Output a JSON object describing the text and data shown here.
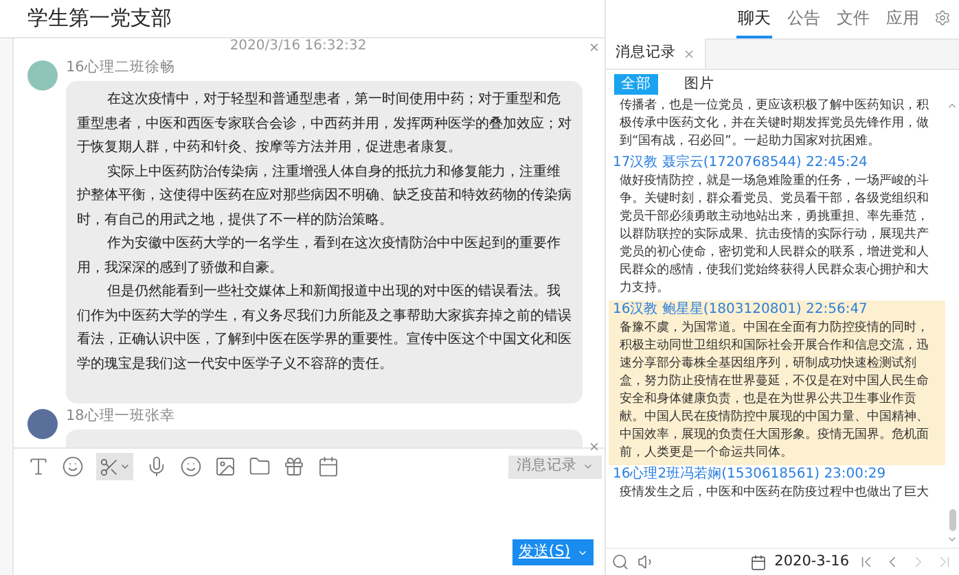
{
  "window": {
    "title": "学生第一党支部"
  },
  "chat": {
    "timestamp": "2020/3/16 16:32:32",
    "messages": [
      {
        "sender": "16心理二班徐畅",
        "paragraphs": [
          "在这次疫情中，对于轻型和普通型患者，第一时间使用中药；对于重型和危重型患者，中医和西医专家联合会诊，中西药并用，发挥两种医学的叠加效应；对于恢复期人群，中药和针灸、按摩等方法并用，促进患者康复。",
          "实际上中医药防治传染病，注重增强人体自身的抵抗力和修复能力，注重维护整体平衡，这使得中医药在应对那些病因不明确、缺乏疫苗和特效药物的传染病时，有自己的用武之地，提供了不一样的防治策略。",
          "作为安徽中医药大学的一名学生，看到在这次疫情防治中中医起到的重要作用，我深深的感到了骄傲和自豪。",
          "但是仍然能看到一些社交媒体上和新闻报道中出现的对中医的错误看法。我们作为中医药大学的学生，有义务尽我们力所能及之事帮助大家摈弃掉之前的错误看法，正确认识中医，了解到中医在医学界的重要性。宣传中医这个中国文化和医学的瑰宝是我们这一代安中医学子义不容辞的责任。"
        ]
      },
      {
        "sender": "18心理一班张幸"
      }
    ]
  },
  "composer": {
    "history_button": "消息记录",
    "send_button": "发送(S)"
  },
  "side_tabs": [
    {
      "label": "聊天",
      "selected": true
    },
    {
      "label": "公告",
      "selected": false
    },
    {
      "label": "文件",
      "selected": false
    },
    {
      "label": "应用",
      "selected": false
    }
  ],
  "history": {
    "tab_title": "消息记录",
    "filters": [
      {
        "label": "全部",
        "selected": true
      },
      {
        "label": "图片",
        "selected": false
      }
    ],
    "entries": [
      {
        "highlighted": false,
        "text": "传播者，也是一位党员，更应该积极了解中医药知识，积极传承中医药文化，并在关键时期发挥党员先锋作用，做到“国有战，召必回”。一起助力国家对抗困难。"
      },
      {
        "header": "17汉教 聂宗云(1720768544) 22:45:24",
        "highlighted": false,
        "text": "做好疫情防控，就是一场急难险重的任务，一场严峻的斗争。关键时刻，群众看党员、党员看干部，各级党组织和党员干部必须勇敢主动地站出来，勇挑重担、率先垂范，以群防联控的实际成果、抗击疫情的实际行动，展现共产党员的初心使命，密切党和人民群众的联系，增进党和人民群众的感情，使我们党始终获得人民群众衷心拥护和大力支持。"
      },
      {
        "header": "16汉教 鲍星星(1803120801) 22:56:47",
        "highlighted": true,
        "text": "备豫不虞，为国常道。中国在全面有力防控疫情的同时，积极主动同世卫组织和国际社会开展合作和信息交流，迅速分享部分毒株全基因组序列，研制成功快速检测试剂盒，努力防止疫情在世界蔓延，不仅是在对中国人民生命安全和身体健康负责，也是在为世界公共卫生事业作贡献。中国人民在疫情防控中展现的中国力量、中国精神、中国效率，展现的负责任大国形象。疫情无国界。危机面前，人类更是一个命运共同体。"
      },
      {
        "header": "16心理2班冯若娴(1530618561) 23:00:29",
        "highlighted": false,
        "text": "疫情发生之后，中医和中医药在防疫过程中也做出了巨大"
      }
    ],
    "date": "2020-3-16"
  }
}
